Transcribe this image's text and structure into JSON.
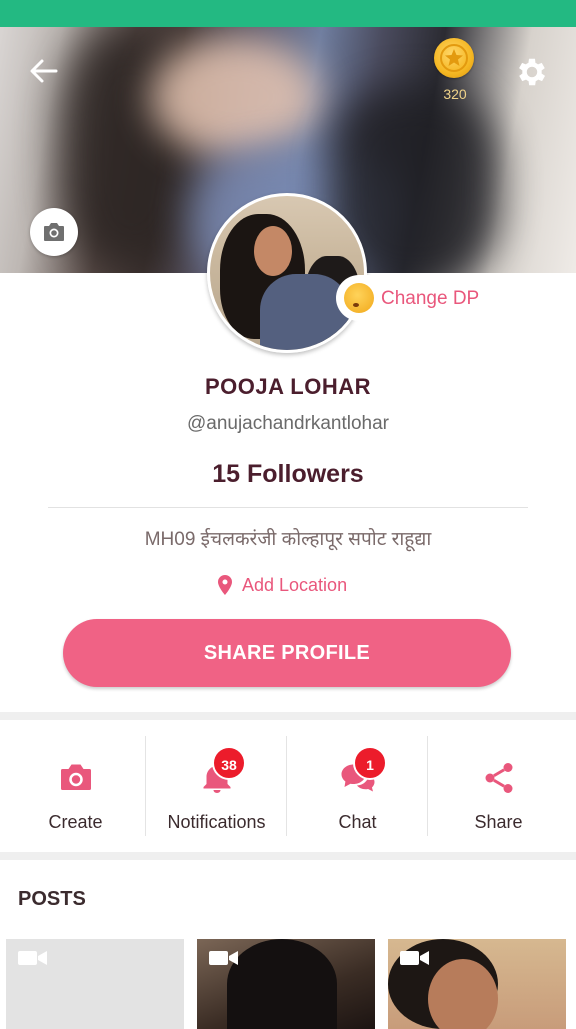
{
  "header": {
    "coin_count": "320"
  },
  "profile": {
    "change_dp_label": "Change DP",
    "name": "POOJA  LOHAR",
    "handle": "@anujachandrkantlohar",
    "followers": "15 Followers",
    "bio": "MH09 ईचलकरंजी कोल्हापूर सपोट राहूद्या",
    "add_location": "Add Location",
    "share_profile": "SHARE PROFILE"
  },
  "actions": [
    {
      "label": "Create",
      "icon": "camera-icon"
    },
    {
      "label": "Notifications",
      "icon": "bell-icon",
      "badge": "38"
    },
    {
      "label": "Chat",
      "icon": "chat-icon",
      "badge": "1"
    },
    {
      "label": "Share",
      "icon": "share-icon"
    }
  ],
  "posts": {
    "title": "POSTS"
  },
  "colors": {
    "status_bar": "#23b982",
    "accent": "#f06285",
    "accent_text": "#e9577c",
    "badge": "#ec1c2b",
    "name_text": "#4b1e2d"
  }
}
